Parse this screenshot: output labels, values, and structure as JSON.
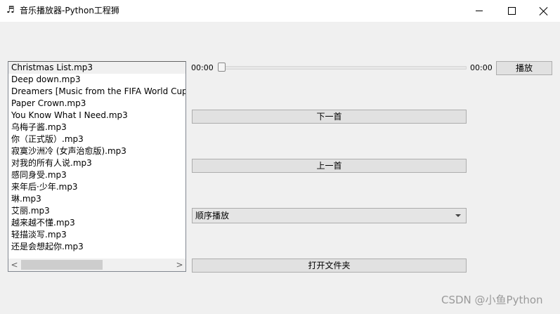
{
  "window": {
    "icon": "music-note-icon",
    "title": "音乐播放器-Python工程狮"
  },
  "playlist": {
    "items": [
      "Christmas List.mp3",
      "Deep down.mp3",
      "Dreamers [Music from the FIFA World Cup",
      "Paper Crown.mp3",
      "You Know What I Need.mp3",
      "乌梅子酱.mp3",
      "你（正式版）.mp3",
      "寂寞沙洲冷 (女声治愈版).mp3",
      "对我的所有人说.mp3",
      "感同身受.mp3",
      "来年后·少年.mp3",
      "琳.mp3",
      "艾丽.mp3",
      "越来越不懂.mp3",
      "轻描淡写.mp3",
      "还是会想起你.mp3"
    ],
    "selected_index": 0,
    "scroll_left": "<",
    "scroll_right": ">"
  },
  "player": {
    "current_time": "00:00",
    "total_time": "00:00",
    "progress": 0,
    "play_label": "播放",
    "next_label": "下一首",
    "prev_label": "上一首",
    "mode_value": "顺序播放",
    "open_folder_label": "打开文件夹"
  },
  "watermark": "CSDN @小鱼Python"
}
